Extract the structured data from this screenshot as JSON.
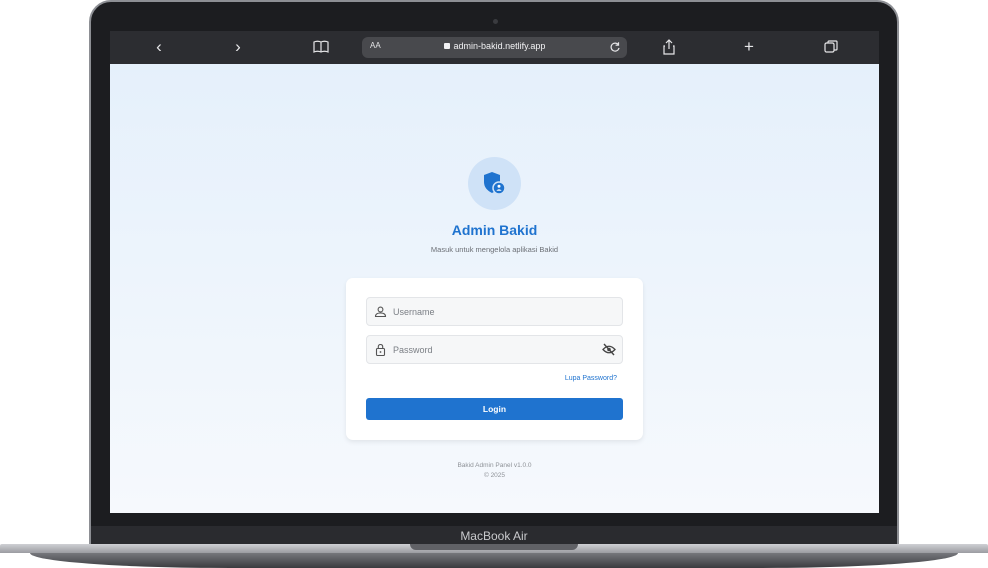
{
  "device": {
    "model_label": "MacBook Air"
  },
  "browser": {
    "url_text": "admin-bakid.netlify.app",
    "text_size_label": "AA",
    "back_glyph": "‹",
    "forward_glyph": "›",
    "new_tab_glyph": "+",
    "icons": [
      "chevron-left-icon",
      "chevron-right-icon",
      "book-icon",
      "lock-icon",
      "reload-icon",
      "share-icon",
      "plus-icon",
      "tabs-icon"
    ]
  },
  "login": {
    "title": "Admin Bakid",
    "subtitle": "Masuk untuk mengelola aplikasi Bakid",
    "username_placeholder": "Username",
    "password_placeholder": "Password",
    "forgot_label": "Lupa Password?",
    "login_label": "Login",
    "icons": [
      "shield-user-icon",
      "user-icon",
      "lock-icon",
      "eye-off-icon"
    ]
  },
  "footer": {
    "version": "Bakid Admin Panel v1.0.0",
    "copyright": "© 2025"
  },
  "colors": {
    "accent": "#1f73cf",
    "logo_bg": "#cfe2f7",
    "page_bg_top": "#e5f0fb",
    "page_bg_bottom": "#f6f9fd",
    "toolbar_bg": "#2c2d31"
  }
}
